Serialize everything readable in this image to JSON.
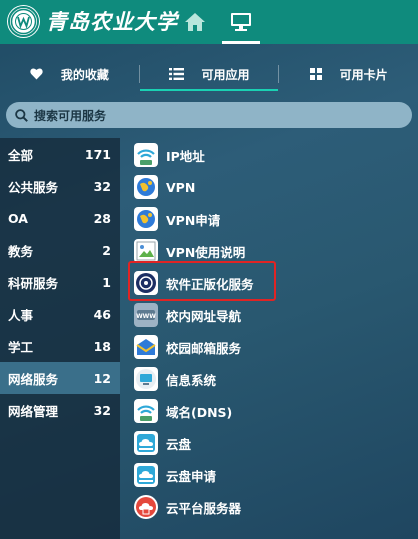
{
  "header": {
    "school_name": "青岛农业大学",
    "nav": [
      {
        "name": "home",
        "icon": "home-icon"
      },
      {
        "name": "desktop",
        "icon": "desktop-icon",
        "active": true
      }
    ]
  },
  "tabs": [
    {
      "label": "我的收藏",
      "icon": "heart-icon"
    },
    {
      "label": "可用应用",
      "icon": "list-icon",
      "active": true
    },
    {
      "label": "可用卡片",
      "icon": "grid-icon"
    }
  ],
  "search": {
    "placeholder": "搜索可用服务",
    "icon": "search-icon"
  },
  "categories": [
    {
      "label": "全部",
      "count": "171"
    },
    {
      "label": "公共服务",
      "count": "32"
    },
    {
      "label": "OA",
      "count": "28"
    },
    {
      "label": "教务",
      "count": "2"
    },
    {
      "label": "科研服务",
      "count": "1"
    },
    {
      "label": "人事",
      "count": "46"
    },
    {
      "label": "学工",
      "count": "18"
    },
    {
      "label": "网络服务",
      "count": "12",
      "active": true
    },
    {
      "label": "网络管理",
      "count": "32"
    }
  ],
  "apps": [
    {
      "label": "IP地址",
      "icon": "wifi-icon"
    },
    {
      "label": "VPN",
      "icon": "globe-icon"
    },
    {
      "label": "VPN申请",
      "icon": "globe-icon"
    },
    {
      "label": "VPN使用说明",
      "icon": "broken-image-icon"
    },
    {
      "label": "软件正版化服务",
      "icon": "disc-icon"
    },
    {
      "label": "校内网址导航",
      "icon": "www-icon"
    },
    {
      "label": "校园邮箱服务",
      "icon": "mail-icon"
    },
    {
      "label": "信息系统",
      "icon": "monitor-icon"
    },
    {
      "label": "域名(DNS)",
      "icon": "wifi-icon"
    },
    {
      "label": "云盘",
      "icon": "cloud-icon"
    },
    {
      "label": "云盘申请",
      "icon": "cloud-icon"
    },
    {
      "label": "云平台服务器",
      "icon": "cloud-server-icon"
    }
  ],
  "colors": {
    "header_bg": "#0f8b7d",
    "tab_underline": "#1ad1b3",
    "highlight_border": "#e02424",
    "sidebar_active": "#3a6f8a"
  }
}
